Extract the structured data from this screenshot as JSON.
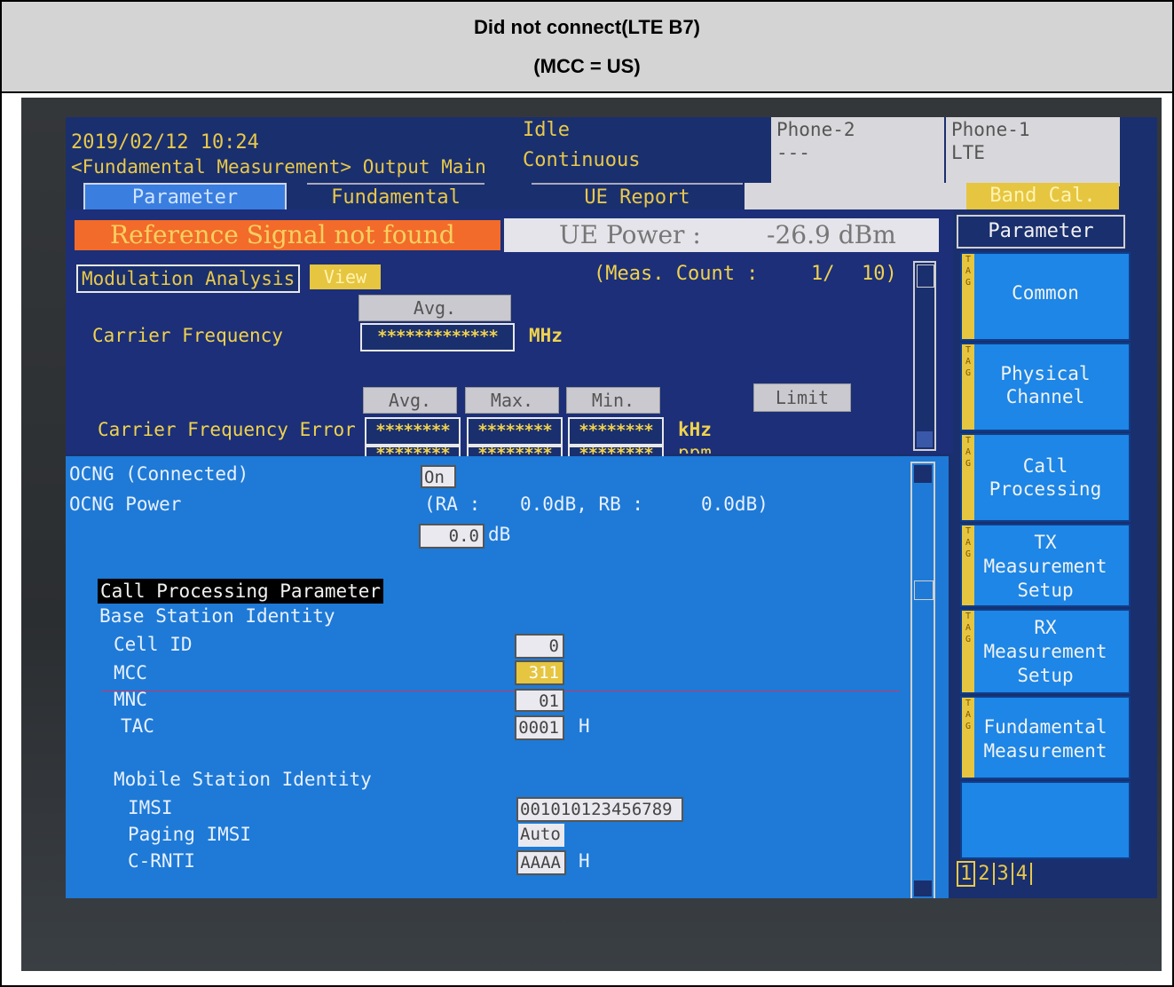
{
  "caption": {
    "line1": "Did not connect(LTE B7)",
    "line2": "(MCC = US)"
  },
  "header": {
    "datetime": "2019/02/12 10:24",
    "breadcrumb": "<Fundamental Measurement> Output Main",
    "status1": "Idle",
    "status2": "Continuous",
    "phone2_label": "Phone-2",
    "phone2_value": "---",
    "phone1_label": "Phone-1",
    "phone1_value": "LTE"
  },
  "tabs": {
    "parameter": "Parameter",
    "fundamental": "Fundamental",
    "ue_report": "UE Report",
    "band_cal": "Band Cal."
  },
  "measurement": {
    "alert": "Reference Signal not found",
    "ue_power_label": "UE Power :",
    "ue_power_value": "-26.9 dBm",
    "section": "Modulation Analysis",
    "view_btn": "View",
    "meas_count_label": "(Meas. Count :",
    "meas_count_value": "1/",
    "meas_count_total": "10)",
    "avg_label": "Avg.",
    "carrier_freq_label": "Carrier Frequency",
    "carrier_freq_value": "*************",
    "carrier_freq_unit": "MHz",
    "avg2": "Avg.",
    "max": "Max.",
    "min": "Min.",
    "limit": "Limit",
    "cfe_label": "Carrier Frequency Error",
    "cfe_avg": "********",
    "cfe_max": "********",
    "cfe_min": "********",
    "cfe_unit": "kHz",
    "cfe_row2": "********",
    "cfe_unit2": "ppm"
  },
  "params": {
    "ocng_label": "OCNG (Connected)",
    "ocng_value": "On",
    "ocng_power_label": "OCNG Power",
    "ra_label": "(RA :",
    "ra_value": "0.0dB, RB :",
    "rb_value": "0.0dB)",
    "ocng_power_value": "0.0",
    "ocng_power_unit": "dB",
    "call_proc_header": "Call Processing Parameter",
    "bs_identity": "Base Station Identity",
    "cell_id_label": "Cell ID",
    "cell_id_value": "0",
    "mcc_label": "MCC",
    "mcc_value": "311",
    "mnc_label": "MNC",
    "mnc_value": "01",
    "tac_label": "TAC",
    "tac_value": "0001",
    "tac_unit": "H",
    "ms_identity": "Mobile Station Identity",
    "imsi_label": "IMSI",
    "imsi_value": "001010123456789",
    "paging_label": "Paging IMSI",
    "paging_value": "Auto",
    "crnti_label": "C-RNTI",
    "crnti_value": "AAAA",
    "crnti_unit": "H"
  },
  "sidebar": {
    "title": "Parameter",
    "items": [
      {
        "line1": "Common",
        "line2": "",
        "line3": ""
      },
      {
        "line1": "Physical",
        "line2": "Channel",
        "line3": ""
      },
      {
        "line1": "Call",
        "line2": "Processing",
        "line3": ""
      },
      {
        "line1": "TX",
        "line2": "Measurement",
        "line3": "Setup"
      },
      {
        "line1": "RX",
        "line2": "Measurement",
        "line3": "Setup"
      },
      {
        "line1": "Fundamental",
        "line2": "Measurement",
        "line3": ""
      }
    ],
    "pages": [
      "1",
      "2",
      "3",
      "4"
    ]
  }
}
